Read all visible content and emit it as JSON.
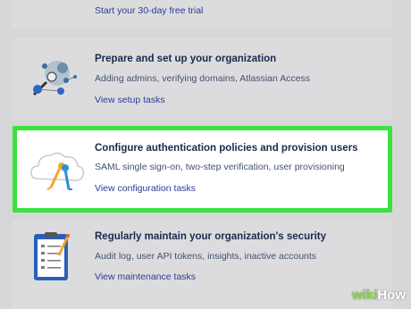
{
  "trial_card": {
    "link": "Start your 30-day free trial"
  },
  "tasks": [
    {
      "title": "Prepare and set up your organization",
      "description": "Adding admins, verifying domains, Atlassian Access",
      "link": "View setup tasks",
      "illustration": "network-magnifier-icon"
    },
    {
      "title": "Configure authentication policies and provision users",
      "description": "SAML single sign-on, two-step verification, user provisioning",
      "link": "View configuration tasks",
      "illustration": "cloud-keys-icon"
    },
    {
      "title": "Regularly maintain your organization's security",
      "description": "Audit log, user API tokens, insights, inactive accounts",
      "link": "View maintenance tasks",
      "illustration": "clipboard-checklist-icon"
    }
  ],
  "watermark": {
    "prefix": "wiki",
    "suffix": "How"
  },
  "colors": {
    "highlight": "#3de13d",
    "title": "#172b4d",
    "link": "#2f3a8f"
  }
}
